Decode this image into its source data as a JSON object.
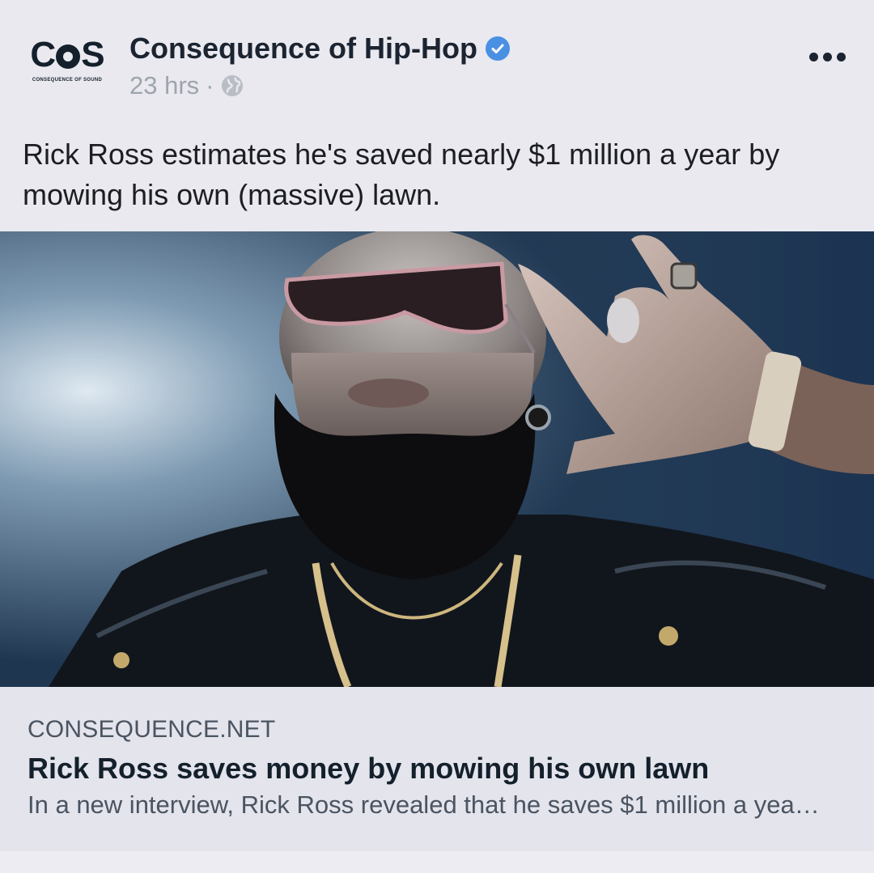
{
  "post": {
    "page_name": "Consequence of Hip-Hop",
    "logo_text": "CoS",
    "logo_subtext": "CONSEQUENCE OF SOUND",
    "timestamp": "23 hrs",
    "separator": "·",
    "audience_icon": "globe-icon",
    "verified_icon": "verified-badge-icon",
    "more_icon": "more-options-icon",
    "caption": "Rick Ross estimates he's saved nearly $1 million a year by mowing his own (massive) lawn."
  },
  "photo": {
    "description_icon": "article-photo"
  },
  "link_preview": {
    "domain": "CONSEQUENCE.NET",
    "title": "Rick Ross saves money by mowing his own lawn",
    "description": "In a new interview, Rick Ross revealed that he saves $1 million a yea…"
  },
  "colors": {
    "verified": "#4a90e2",
    "background": "#e9e9ef",
    "link_background": "#e3e4ec",
    "text_dark": "#14202b",
    "text_muted": "#9ea4ad"
  }
}
